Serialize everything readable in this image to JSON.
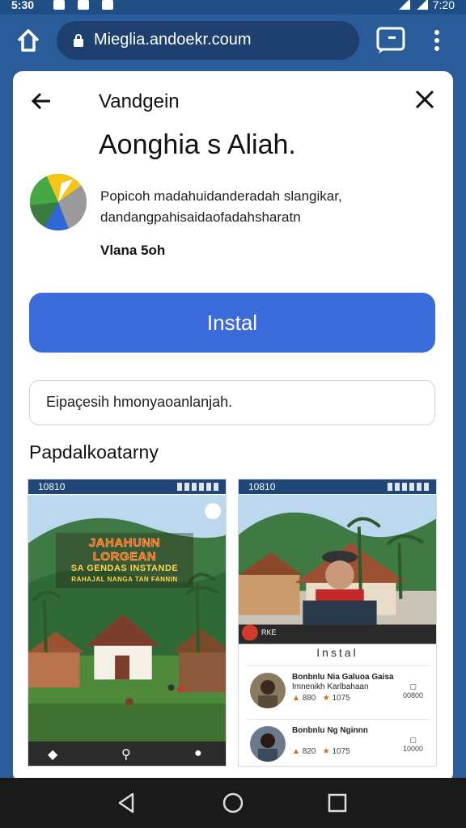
{
  "status_bar": {
    "time": "5:30",
    "right_time": "7:20"
  },
  "browser": {
    "url": "Mieglia.andoekr.coum"
  },
  "sheet": {
    "header_title": "Vandgein",
    "app_name": "Aonghia s Aliah.",
    "description": "Popicoh madahuidanderadah slangikar, dandangpahisaidaofadahsharatn",
    "developer": "Vlana 5oh",
    "install_label": "Instal",
    "note": "Eipaçesih hmonyaoanlanjah.",
    "screenshots_title": "Papdalkoatarny"
  },
  "screenshot_1": {
    "status_time": "10810",
    "banner_line1": "JAHAHUNN LORGEAN",
    "banner_line2": "SA GENDAS INSTANDE",
    "banner_line3": "RAHAJAL NANGA TAN FANNIN"
  },
  "screenshot_2": {
    "status_time": "10810",
    "badge": "RKE",
    "install_label": "Instal",
    "items": [
      {
        "title": "Bonbnlu Nia Galuoa Gaisa",
        "subtitle": "Imnenikh Karlbahaan",
        "stat1": "880",
        "stat2": "1075",
        "right": "00800"
      },
      {
        "title": "Bonbnlu Ng Nginnn",
        "subtitle": "",
        "stat1": "820",
        "stat2": "1075",
        "right": "10000"
      }
    ]
  },
  "colors": {
    "accent": "#3a6bd9",
    "toolbar": "#2b5c9a",
    "nav": "#1a1a1a"
  }
}
